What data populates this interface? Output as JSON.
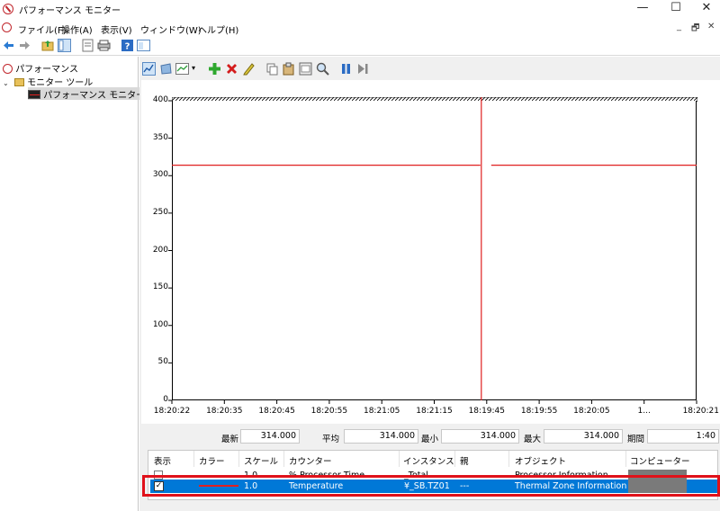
{
  "window": {
    "title": "パフォーマンス モニター",
    "controls": {
      "minimize": "—",
      "maximize": "☐",
      "close": "✕"
    }
  },
  "menu": {
    "items": [
      "ファイル(F)",
      "操作(A)",
      "表示(V)",
      "ウィンドウ(W)",
      "ヘルプ(H)"
    ],
    "mdi_controls": [
      "_",
      "🗗",
      "✕"
    ]
  },
  "tree": {
    "root": "パフォーマンス",
    "group": "モニター ツール",
    "selected": "パフォーマンス モニター"
  },
  "graph": {
    "y_ticks": [
      "400",
      "350",
      "300",
      "250",
      "200",
      "150",
      "100",
      "50",
      "0"
    ],
    "x_ticks": [
      "18:20:22",
      "18:20:35",
      "18:20:45",
      "18:20:55",
      "18:21:05",
      "18:21:15",
      "18:19:45",
      "18:19:55",
      "18:20:05",
      "1...",
      "18:20:21"
    ],
    "line_color": "#e02020"
  },
  "chart_data": {
    "type": "line",
    "ylim": [
      0,
      400
    ],
    "series": [
      {
        "name": "Temperature",
        "values": [
          314,
          314
        ]
      }
    ],
    "current_time_marker": "18:21:15"
  },
  "stats": {
    "latest_label": "最新",
    "latest": "314.000",
    "average_label": "平均",
    "average": "314.000",
    "min_label": "最小",
    "min": "314.000",
    "max_label": "最大",
    "max": "314.000",
    "duration_label": "期間",
    "duration": "1:40"
  },
  "counters": {
    "headers": [
      "表示",
      "カラー",
      "スケール",
      "カウンター",
      "インスタンス",
      "親",
      "オブジェクト",
      "コンピューター"
    ],
    "rows": [
      {
        "show": false,
        "scale": "1.0",
        "counter": "% Processor Time",
        "instance": "_Total",
        "parent": "",
        "object": "Processor Information",
        "computer": ""
      },
      {
        "show": true,
        "scale": "1.0",
        "counter": "Temperature",
        "instance": "¥_SB.TZ01",
        "parent": "---",
        "object": "Thermal Zone Information",
        "computer": ""
      }
    ]
  }
}
